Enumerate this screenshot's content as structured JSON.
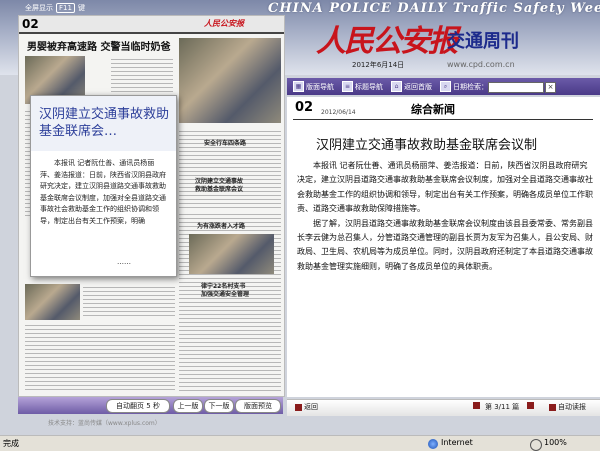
{
  "header": {
    "fullscreen_label": "全屏显示",
    "fullscreen_key": "F11",
    "fullscreen_suffix": "键",
    "banner_en": "CHINA POLICE DAILY Traffic Safety Weekly",
    "logo_text": "人民公安报",
    "supplement_name": "交通周刊",
    "issue_date": "2012年6月14日",
    "url": "www.cpd.com.cn"
  },
  "left_page": {
    "page_num": "02",
    "masthead": "人民公安报",
    "headline": "男婴被弃高速路  交警当临时奶爸",
    "side_heads": [
      "安全行车四条路",
      "汉阴建立交通事故",
      "救助基金联席会议",
      "为有涨跌者入才路",
      "律宁22名村支书",
      "加强交通安全管理"
    ]
  },
  "popup": {
    "title": "汉阴建立交通事故救助基金联席会…",
    "body": "本报讯 记者阮仕善、通讯员杨丽萍、姜浩报道：日前，陕西省汉阴县政府研究决定，建立汉阴县道路交通事故救助基金联席会议制度，加强对全县道路交通事故社会救助基金工作的组织协调和领导，制定出台有关工作预案，明确",
    "more": "……"
  },
  "left_nav": {
    "auto_flip": "自动翻页",
    "interval": "5",
    "seconds": "秒",
    "prev": "上一版",
    "next": "下一版",
    "fullscreen": "版面预览"
  },
  "footer_note": "技术支持：蓝尚传媒（www.xplus.com）",
  "toolbar": {
    "layout_nav": "版面导航",
    "title_nav": "标题导航",
    "back_home": "返回首版",
    "date_search": "日期检索：",
    "search_value": "",
    "close": "×"
  },
  "article": {
    "page_num": "02",
    "date": "2012/06/14",
    "section": "综合新闻",
    "title": "汉阴建立交通事故救助基金联席会议制",
    "paragraphs": [
      "本报讯 记者阮仕善、通讯员杨丽萍、姜浩报道：日前，陕西省汉阴县政府研究决定，建立汉阴县道路交通事故救助基金联席会议制度，加强对全县道路交通事故社会救助基金工作的组织协调和领导，制定出台有关工作预案，明确各成员单位工作职责、道路交通事故救助保障措施等。",
      "据了解，汉阴县道路交通事故救助基金联席会议制度由该县县委常委、常务副县长李云健为总召集人，分管道路交通管理的副县长贾为友军为召集人，县公安局、财政局、卫生局、农机局等为成员单位。同时，汉阴县政府还制定了本县道路交通事故救助基金管理实施细则，明确了各成员单位的具体职责。"
    ]
  },
  "right_nav": {
    "back": "返回",
    "page_info": "第 3/11 篇",
    "next": "下一篇",
    "auto_read": "自动读报"
  },
  "status_bar": {
    "left": "完成",
    "zone": "Internet",
    "zoom": "100%"
  }
}
